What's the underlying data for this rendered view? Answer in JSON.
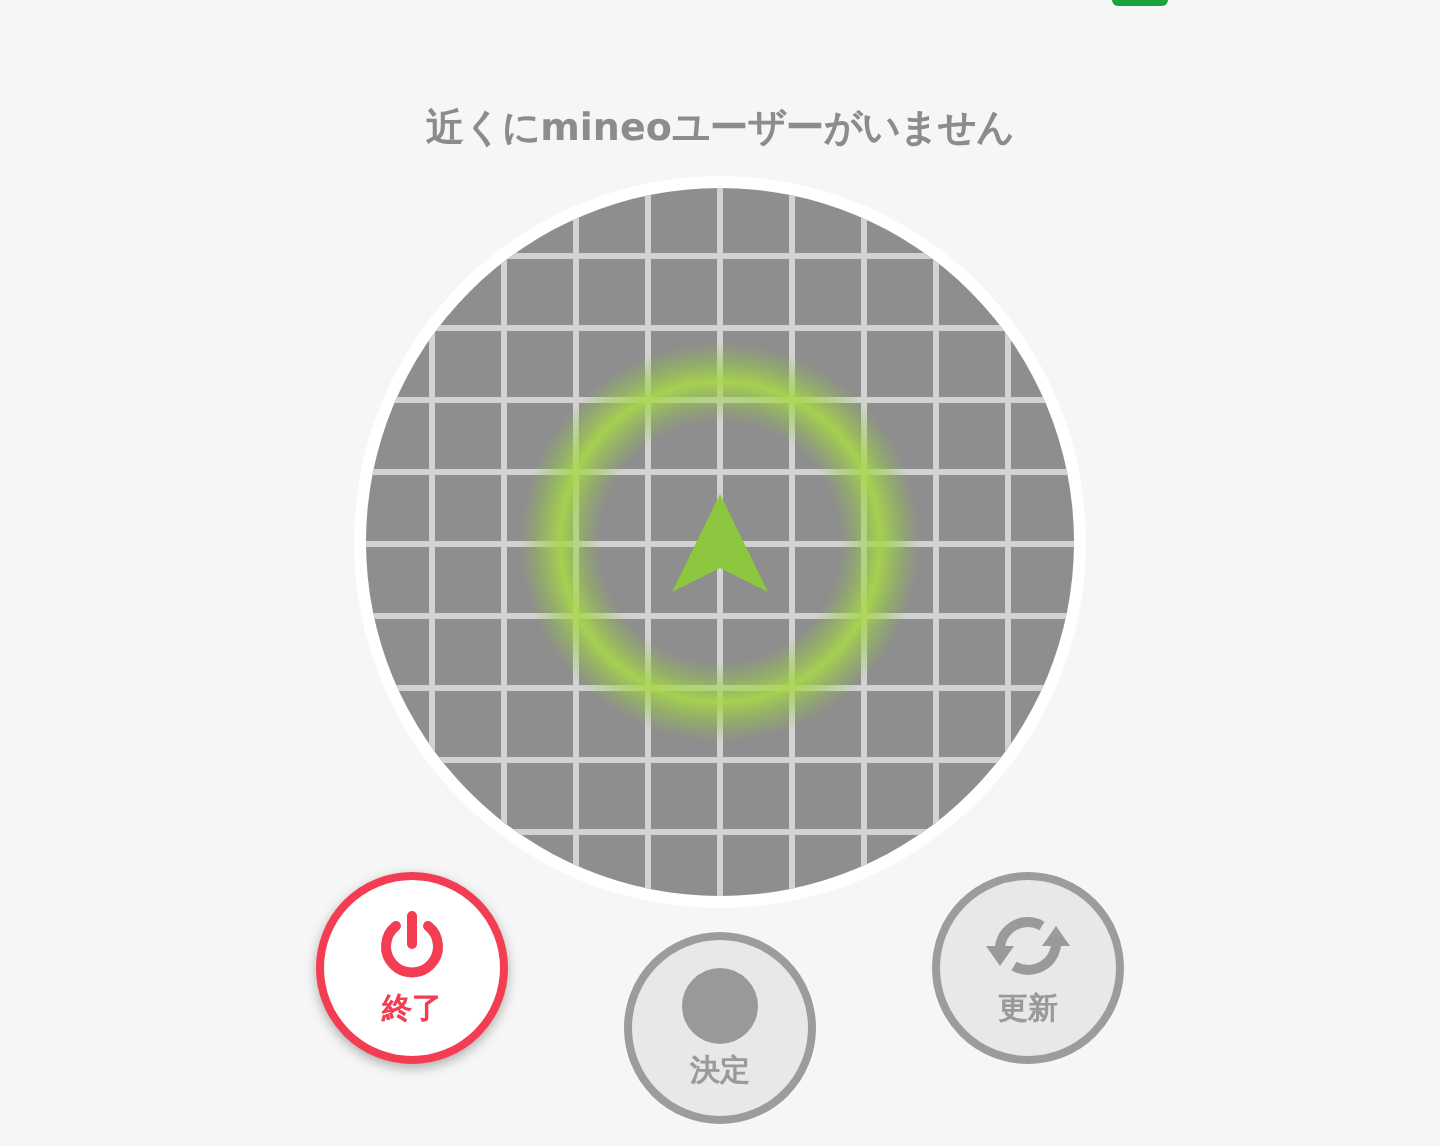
{
  "status": {
    "connected": true
  },
  "message": "近くにmineoユーザーがいません",
  "buttons": [
    {
      "kind": "power",
      "label": "終了",
      "disabled": false
    },
    {
      "kind": "confirm",
      "label": "決定",
      "disabled": true
    },
    {
      "kind": "refresh",
      "label": "更新",
      "disabled": true
    }
  ]
}
